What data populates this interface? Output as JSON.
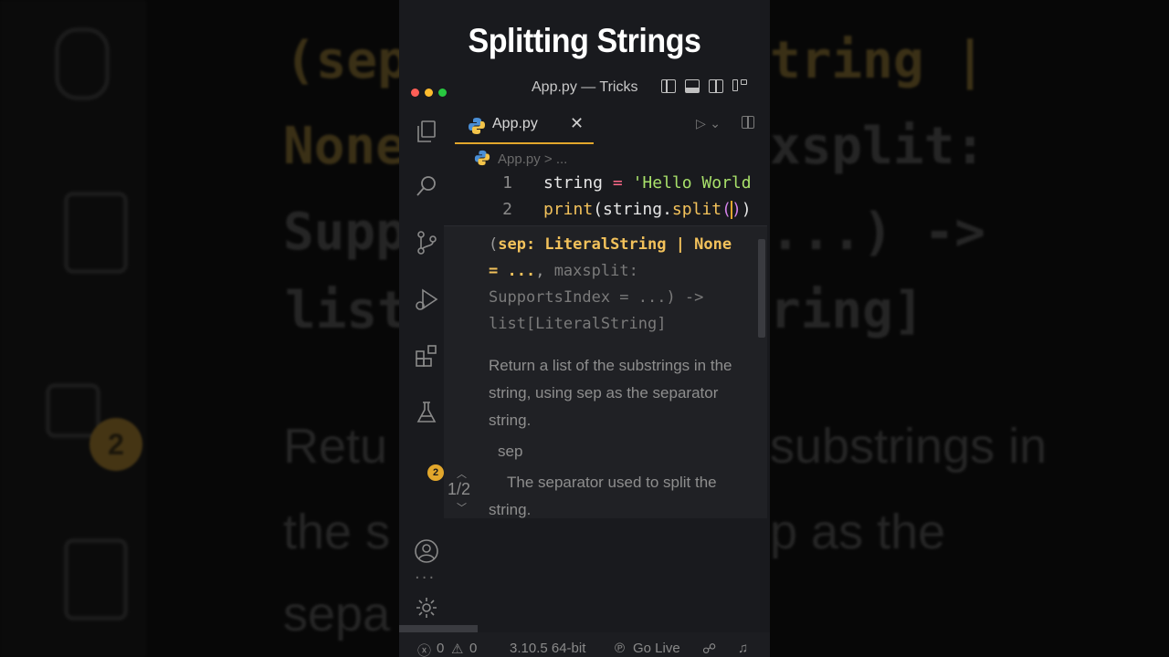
{
  "video_title": "Splitting Strings",
  "window": {
    "title": "App.py — Tricks",
    "traffic_lights": [
      "#ff5f57",
      "#febc2e",
      "#28c840"
    ]
  },
  "tab": {
    "filename": "App.py",
    "close_glyph": "✕"
  },
  "breadcrumb": {
    "file": "App.py",
    "more": "..."
  },
  "code": [
    {
      "number": "1",
      "tokens": {
        "var": "string",
        "op": "=",
        "str": "'Hello World"
      }
    },
    {
      "number": "2",
      "tokens": {
        "fn": "print",
        "open": "(",
        "var": "string",
        "dot": ".",
        "method": "split",
        "p_open": "(",
        "p_close": ")",
        "close": ")"
      }
    }
  ],
  "hover": {
    "sig_open": "(",
    "sig_hl": "sep: LiteralString | None = ...",
    "sig_comma": ",",
    "sig_rest": "maxsplit: SupportsIndex = ...) -> list[LiteralString]",
    "description": "Return a list of the substrings in the string, using sep as the separator string.",
    "param_name": "sep",
    "param_desc": "The separator used to split the string.",
    "counter": "1/2"
  },
  "activity_badge": "2",
  "activity_more": "...",
  "status": {
    "errors": "0",
    "warnings": "0",
    "python": "3.10.5 64-bit",
    "live": "Go Live"
  },
  "background": {
    "code_line1_a": "(sep",
    "code_line1_b": "tring |",
    "code_line2_a": "None",
    "code_line2_b": "xsplit:",
    "code_line3_a": "Supp",
    "code_line3_b": "...) ->",
    "code_line4_a": "list",
    "code_line4_b": "ring]",
    "doc_line1_a": "Retu",
    "doc_line1_b": "substrings in",
    "doc_line2_a": "the s",
    "doc_line2_b": "p as the",
    "doc_line3_a": "sepa",
    "badge": "2"
  },
  "colors": {
    "accent": "#e2a72c",
    "string": "#a8e06a",
    "operator": "#ff6a8a",
    "function": "#f3c25b",
    "paren": "#d080e6"
  }
}
